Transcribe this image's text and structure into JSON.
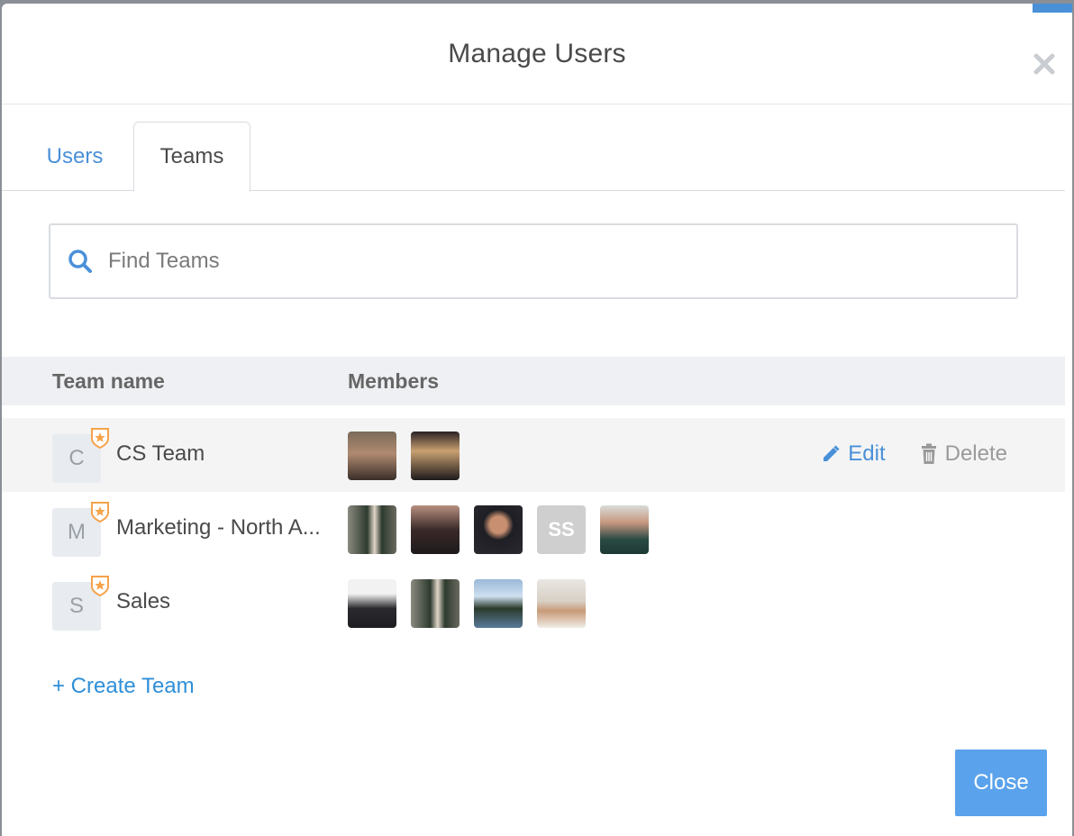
{
  "modal": {
    "title": "Manage Users",
    "close_label": "Close"
  },
  "tabs": [
    {
      "label": "Users",
      "active": false
    },
    {
      "label": "Teams",
      "active": true
    }
  ],
  "search": {
    "placeholder": "Find Teams",
    "value": ""
  },
  "table": {
    "headers": {
      "team_name": "Team name",
      "members": "Members"
    },
    "rows": [
      {
        "initial": "C",
        "name": "CS Team",
        "highlighted": true,
        "members": [
          {
            "type": "photo",
            "tone": "#6b4a3a"
          },
          {
            "type": "photo",
            "tone": "#8a6a4a"
          }
        ]
      },
      {
        "initial": "M",
        "name": "Marketing - North A...",
        "highlighted": false,
        "members": [
          {
            "type": "photo",
            "tone": "#4a4f46"
          },
          {
            "type": "photo",
            "tone": "#3b2f2d"
          },
          {
            "type": "photo",
            "tone": "#2a2a30"
          },
          {
            "type": "initials",
            "text": "SS",
            "tone": "#cfcfcf"
          },
          {
            "type": "photo",
            "tone": "#2f4a44"
          }
        ]
      },
      {
        "initial": "S",
        "name": "Sales",
        "highlighted": false,
        "members": [
          {
            "type": "photo",
            "tone": "#3a3a3e"
          },
          {
            "type": "photo",
            "tone": "#4a4f46"
          },
          {
            "type": "photo",
            "tone": "#5a7a8a"
          },
          {
            "type": "photo",
            "tone": "#c8c0b4"
          }
        ]
      }
    ],
    "row_actions": {
      "edit": "Edit",
      "delete": "Delete"
    }
  },
  "create_team_label": "+ Create Team",
  "colors": {
    "accent": "#4a90d9",
    "badge": "#f5a34a",
    "primary_button": "#5aa2ec"
  },
  "icons": {
    "search": "search-icon",
    "close": "close-icon",
    "badge": "admin-star-badge-icon",
    "edit": "pencil-icon",
    "delete": "trash-icon"
  }
}
